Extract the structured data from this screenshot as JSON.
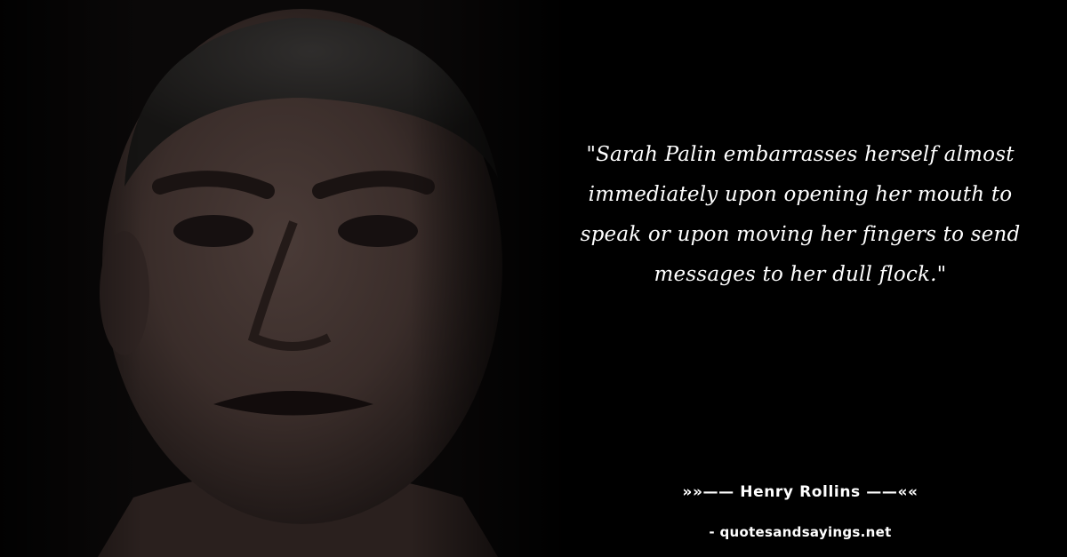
{
  "quote": {
    "text": "\"Sarah Palin embarrasses herself almost immediately upon opening her mouth to speak or upon moving her fingers to send messages to her dull flock.\""
  },
  "attribution": {
    "author_line": "»»—— Henry Rollins ——««"
  },
  "source": {
    "site_line": "- quotesandsayings.net"
  },
  "colors": {
    "background": "#000000",
    "text": "#ffffff"
  }
}
